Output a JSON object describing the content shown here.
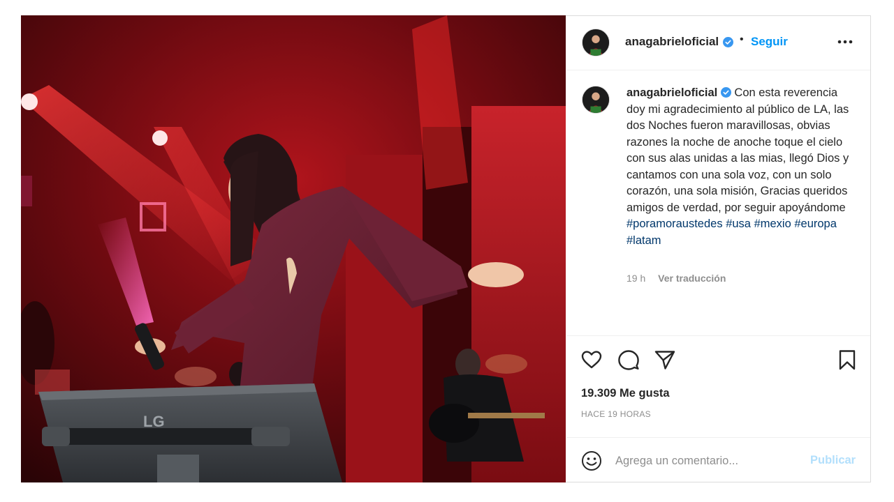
{
  "post": {
    "username": "anagabrieloficial",
    "verified": true,
    "follow_separator": "•",
    "follow_label": "Seguir",
    "caption_text": "Con esta reverencia doy mi agradecimiento al público de LA, las dos Noches fueron maravillosas, obvias razones la noche de anoche toque el cielo con sus alas unidas a las mias, llegó Dios y cantamos con una sola voz, con un solo corazón, una sola misión, Gracias queridos amigos de verdad, por seguir apoyándome",
    "hashtags": [
      "#poramoraustedes",
      "#usa",
      "#mexio",
      "#europa",
      "#latam"
    ],
    "caption_time": "19 h",
    "translate_label": "Ver traducción",
    "likes_label": "19.309 Me gusta",
    "time_ago": "HACE 19 HORAS",
    "comment_placeholder": "Agrega un comentario...",
    "publish_label": "Publicar",
    "photo_watermark": "LG"
  },
  "icons": {
    "more": "more-horizontal-icon",
    "like": "heart-icon",
    "comment": "comment-bubble-icon",
    "share": "send-paper-plane-icon",
    "save": "bookmark-icon",
    "emoji": "emoji-smile-icon",
    "verified": "verified-badge-icon"
  },
  "colors": {
    "link_blue": "#0095f6",
    "publish_disabled": "#b2dffc",
    "hashtag": "#00376b",
    "verified_blue": "#3897f0",
    "text": "#262626",
    "muted": "#8e8e8e"
  }
}
